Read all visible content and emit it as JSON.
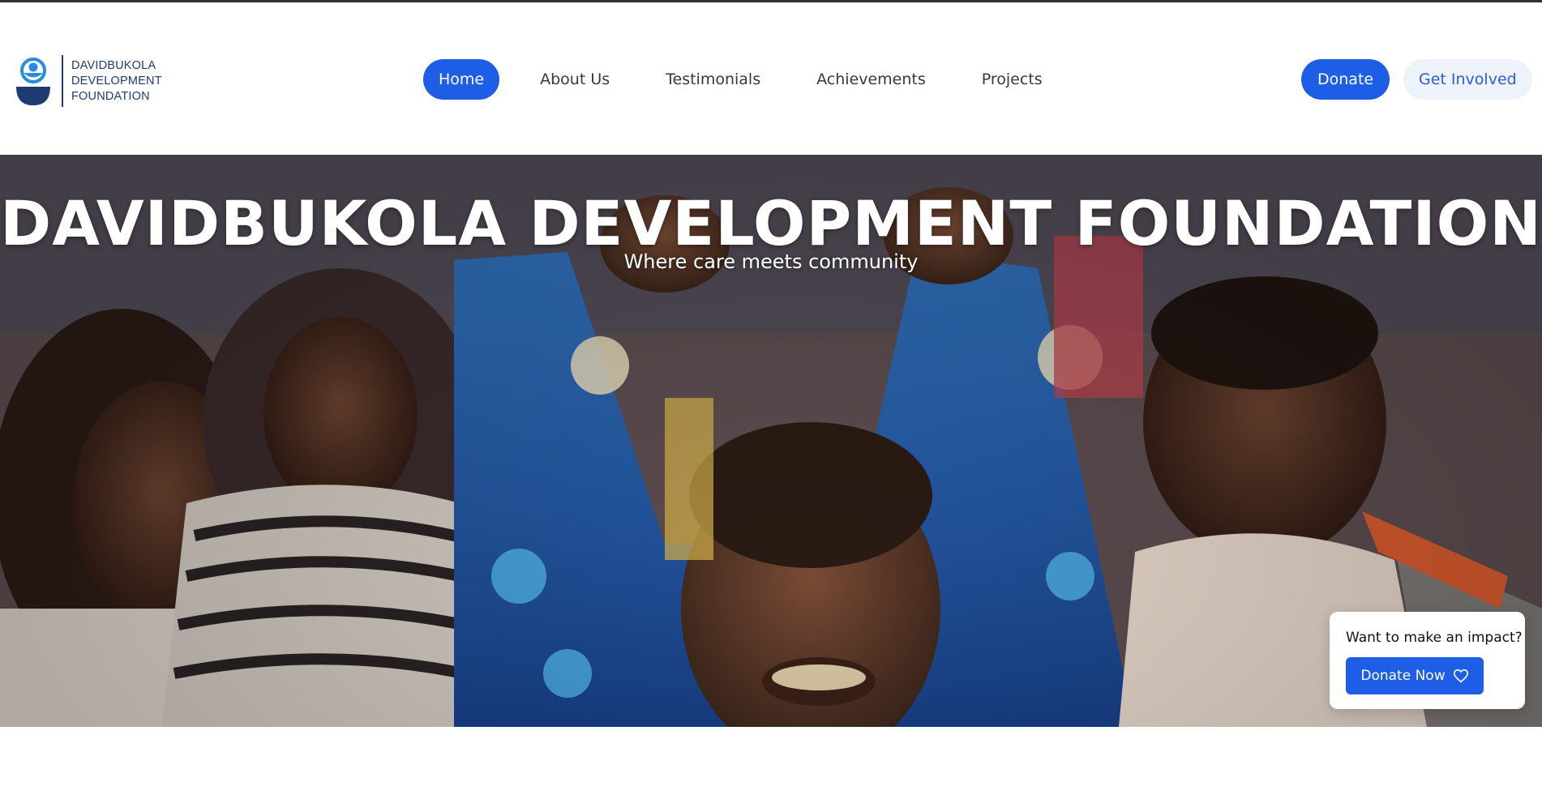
{
  "brand": {
    "lines": [
      "DAVIDBUKOLA",
      "DEVELOPMENT",
      "FOUNDATION"
    ],
    "primary_color": "#1f3b73",
    "accent_color": "#1e5ee6"
  },
  "nav": {
    "items": [
      {
        "label": "Home",
        "active": true
      },
      {
        "label": "About Us",
        "active": false
      },
      {
        "label": "Testimonials",
        "active": false
      },
      {
        "label": "Achievements",
        "active": false
      },
      {
        "label": "Projects",
        "active": false
      }
    ]
  },
  "header_actions": {
    "donate_label": "Donate",
    "get_involved_label": "Get Involved"
  },
  "hero": {
    "title": "DAVIDBUKOLA DEVELOPMENT FOUNDATION",
    "subtitle": "Where care meets community"
  },
  "impact_card": {
    "question": "Want to make an impact?",
    "button_label": "Donate Now",
    "button_icon": "heart-icon"
  }
}
